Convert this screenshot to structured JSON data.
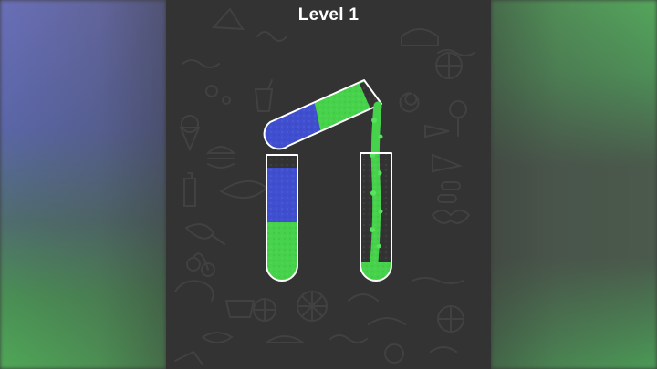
{
  "level": {
    "title": "Level 1"
  },
  "colors": {
    "background": "#333333",
    "liquid_blue": "#3f4fd0",
    "liquid_green": "#46d24a",
    "tube_outline": "#ffffff",
    "doodle": "#3d3d3d"
  },
  "tubes": [
    {
      "name": "tilted-pouring-tube",
      "state": "pouring",
      "layers": [
        "green",
        "blue"
      ]
    },
    {
      "name": "left-tube",
      "state": "standing",
      "layers_bottom_to_top": [
        "green",
        "blue"
      ]
    },
    {
      "name": "right-tube",
      "state": "receiving",
      "layers_bottom_to_top": [
        "green"
      ]
    }
  ]
}
